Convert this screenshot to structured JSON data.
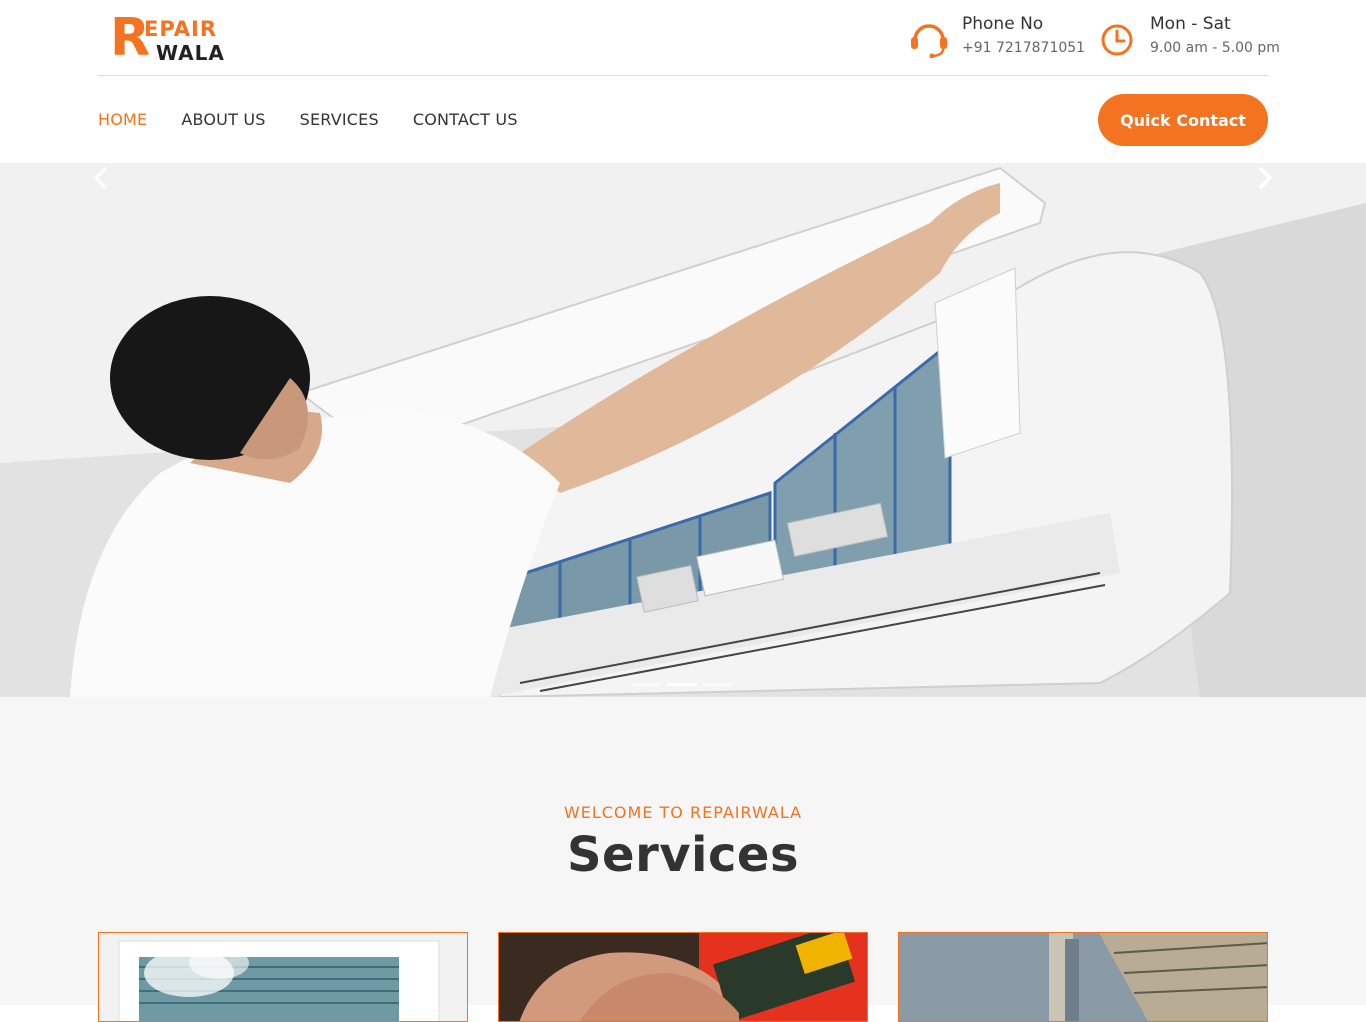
{
  "brand": {
    "logo_letter": "R",
    "logo_line1": "EPAIR",
    "logo_line2": "WALA",
    "accent_color": "#f47321"
  },
  "header": {
    "phone": {
      "title": "Phone No",
      "value": "+91 7217871051",
      "icon": "headset-icon"
    },
    "hours": {
      "title": "Mon - Sat",
      "value": "9.00 am - 5.00 pm",
      "icon": "clock-icon"
    }
  },
  "nav": {
    "items": [
      {
        "label": "HOME",
        "active": true
      },
      {
        "label": "ABOUT US",
        "active": false
      },
      {
        "label": "SERVICES",
        "active": false
      },
      {
        "label": "CONTACT US",
        "active": false
      }
    ],
    "cta_label": "Quick Contact"
  },
  "hero": {
    "slide_count": 3,
    "active_slide": 2,
    "prev_icon": "chevron-left-icon",
    "next_icon": "chevron-right-icon"
  },
  "services": {
    "eyebrow": "WELCOME TO REPAIRWALA",
    "title": "Services",
    "cards": [
      {
        "image": "ac-unit-steam-image"
      },
      {
        "image": "circuit-board-repair-image"
      },
      {
        "image": "pipe-ceiling-image"
      }
    ]
  }
}
